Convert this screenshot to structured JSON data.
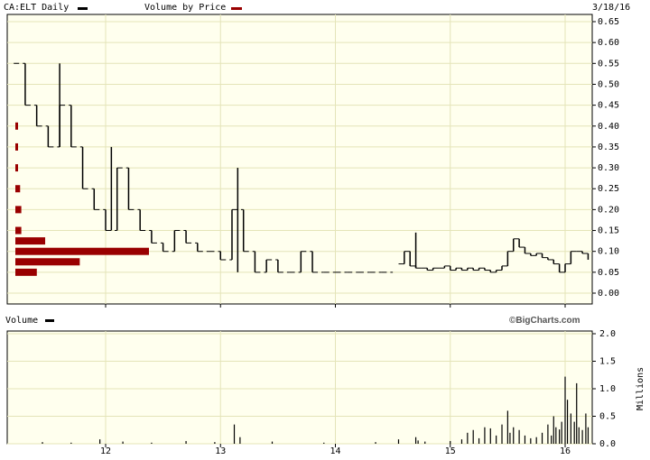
{
  "header": {
    "price_legend": "CA:ELT Daily",
    "volume_by_price_legend": "Volume by Price",
    "date": "3/18/16"
  },
  "volume_panel": {
    "legend": "Volume",
    "brand": "©BigCharts.com"
  },
  "colors": {
    "background": "#ffffee",
    "grid": "#e4e4b8",
    "price": "#000000",
    "volume_by_price": "#990000",
    "volume": "#000000"
  },
  "chart_data": [
    {
      "type": "line",
      "title": "CA:ELT Daily",
      "style": "daily high-low bars",
      "ylim": [
        0.0,
        0.65
      ],
      "y_ticks": [
        "0.00",
        "0.05",
        "0.10",
        "0.15",
        "0.20",
        "0.25",
        "0.30",
        "0.35",
        "0.40",
        "0.45",
        "0.50",
        "0.55",
        "0.60",
        "0.65"
      ],
      "x_tick_labels": [
        "12",
        "13",
        "14",
        "15",
        "16"
      ],
      "grid": true,
      "series": [
        {
          "segments": [
            {
              "x": [
                11.2,
                11.3,
                11.4,
                11.5,
                11.6,
                11.7,
                11.8,
                11.9,
                12.0,
                12.1,
                12.2,
                12.3,
                12.4,
                12.5,
                12.6,
                12.7,
                12.8,
                12.9,
                13.0,
                13.1,
                13.2,
                13.3,
                13.4,
                13.5,
                13.6,
                13.7,
                13.8,
                13.9,
                14.0,
                14.1,
                14.2,
                14.3,
                14.4,
                14.5
              ],
              "y": [
                0.55,
                0.45,
                0.4,
                0.35,
                0.45,
                0.35,
                0.25,
                0.2,
                0.15,
                0.3,
                0.2,
                0.15,
                0.12,
                0.1,
                0.15,
                0.12,
                0.1,
                0.1,
                0.08,
                0.2,
                0.1,
                0.05,
                0.08,
                0.05,
                0.05,
                0.1,
                0.05,
                0.05,
                0.05,
                0.05,
                0.05,
                0.05,
                0.05,
                0.05
              ],
              "gaps": true
            },
            {
              "x": [
                14.55,
                14.6,
                14.65,
                14.7,
                14.75,
                14.8,
                14.85,
                14.9,
                14.95,
                15.0,
                15.05,
                15.1,
                15.15,
                15.2,
                15.25,
                15.3,
                15.35,
                15.4,
                15.45,
                15.5,
                15.55,
                15.6,
                15.65,
                15.7,
                15.75,
                15.8,
                15.85,
                15.9,
                15.95,
                16.0,
                16.05,
                16.1,
                16.15,
                16.2
              ],
              "y": [
                0.07,
                0.1,
                0.065,
                0.06,
                0.06,
                0.055,
                0.06,
                0.06,
                0.065,
                0.055,
                0.06,
                0.055,
                0.06,
                0.055,
                0.06,
                0.055,
                0.05,
                0.055,
                0.065,
                0.1,
                0.13,
                0.11,
                0.095,
                0.09,
                0.095,
                0.085,
                0.08,
                0.07,
                0.05,
                0.07,
                0.1,
                0.1,
                0.095,
                0.08
              ],
              "gaps": false
            }
          ]
        }
      ],
      "spikes": [
        {
          "x": 11.6,
          "low": 0.35,
          "high": 0.55
        },
        {
          "x": 12.05,
          "low": 0.15,
          "high": 0.35
        },
        {
          "x": 13.15,
          "low": 0.05,
          "high": 0.3
        },
        {
          "x": 14.7,
          "low": 0.06,
          "high": 0.145
        }
      ]
    },
    {
      "type": "bar",
      "title": "Volume by Price",
      "orientation": "horizontal",
      "price_levels": [
        0.4,
        0.35,
        0.3,
        0.25,
        0.2,
        0.15,
        0.125,
        0.1,
        0.075,
        0.05
      ],
      "values": [
        0.05,
        0.05,
        0.05,
        0.4,
        0.5,
        0.5,
        2.5,
        11.2,
        5.4,
        1.8
      ]
    },
    {
      "type": "bar",
      "title": "Volume",
      "ylabel": "Millions",
      "ylim": [
        0,
        2.0
      ],
      "y_ticks": [
        "0.0",
        "0.5",
        "1.0",
        "1.5",
        "2.0"
      ],
      "x_tick_labels": [
        "12",
        "13",
        "14",
        "15",
        "16"
      ],
      "grid": true,
      "x": [
        11.45,
        11.7,
        11.95,
        12.15,
        12.4,
        12.7,
        12.95,
        13.12,
        13.17,
        13.45,
        13.9,
        14.35,
        14.55,
        14.7,
        14.72,
        14.78,
        15.0,
        15.1,
        15.15,
        15.2,
        15.25,
        15.3,
        15.35,
        15.4,
        15.45,
        15.5,
        15.52,
        15.55,
        15.6,
        15.65,
        15.7,
        15.75,
        15.8,
        15.85,
        15.88,
        15.9,
        15.92,
        15.95,
        15.97,
        16.0,
        16.02,
        16.05,
        16.08,
        16.1,
        16.12,
        16.15,
        16.18,
        16.2
      ],
      "values": [
        0.03,
        0.02,
        0.08,
        0.04,
        0.02,
        0.05,
        0.03,
        0.35,
        0.12,
        0.04,
        0.02,
        0.03,
        0.08,
        0.12,
        0.06,
        0.04,
        0.05,
        0.08,
        0.2,
        0.25,
        0.1,
        0.3,
        0.28,
        0.15,
        0.35,
        0.6,
        0.2,
        0.3,
        0.25,
        0.15,
        0.1,
        0.12,
        0.2,
        0.35,
        0.15,
        0.5,
        0.3,
        0.26,
        0.4,
        1.22,
        0.8,
        0.55,
        0.4,
        1.1,
        0.3,
        0.25,
        0.55,
        0.3
      ]
    }
  ]
}
